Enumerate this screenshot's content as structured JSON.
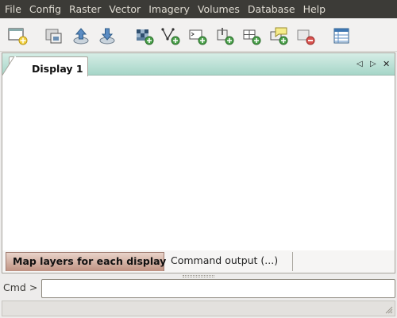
{
  "menubar": {
    "items": [
      "File",
      "Config",
      "Raster",
      "Vector",
      "Imagery",
      "Volumes",
      "Database",
      "Help"
    ]
  },
  "toolbar": {
    "buttons": [
      "new-display-icon",
      "workspace-icon",
      "load-layers-icon",
      "save-workspace-icon",
      "add-raster-icon",
      "add-vector-icon",
      "add-cmd-layer-icon",
      "add-overlay-icon",
      "add-group-icon",
      "add-label-icon",
      "remove-layer-icon",
      "attribute-table-icon"
    ]
  },
  "notebook": {
    "tab_label": "Display 1",
    "controls": [
      "◁",
      "▷",
      "✕"
    ]
  },
  "bottom_tabs": {
    "active": "Map layers for each display",
    "inactive": "Command output (...)"
  },
  "command": {
    "label": "Cmd >",
    "value": ""
  },
  "statusbar": {
    "text": ""
  },
  "colors": {
    "menubar_bg": "#3c3b37",
    "notebook_header": "#a6d6c8",
    "active_bottom_tab": "#bf9282"
  }
}
